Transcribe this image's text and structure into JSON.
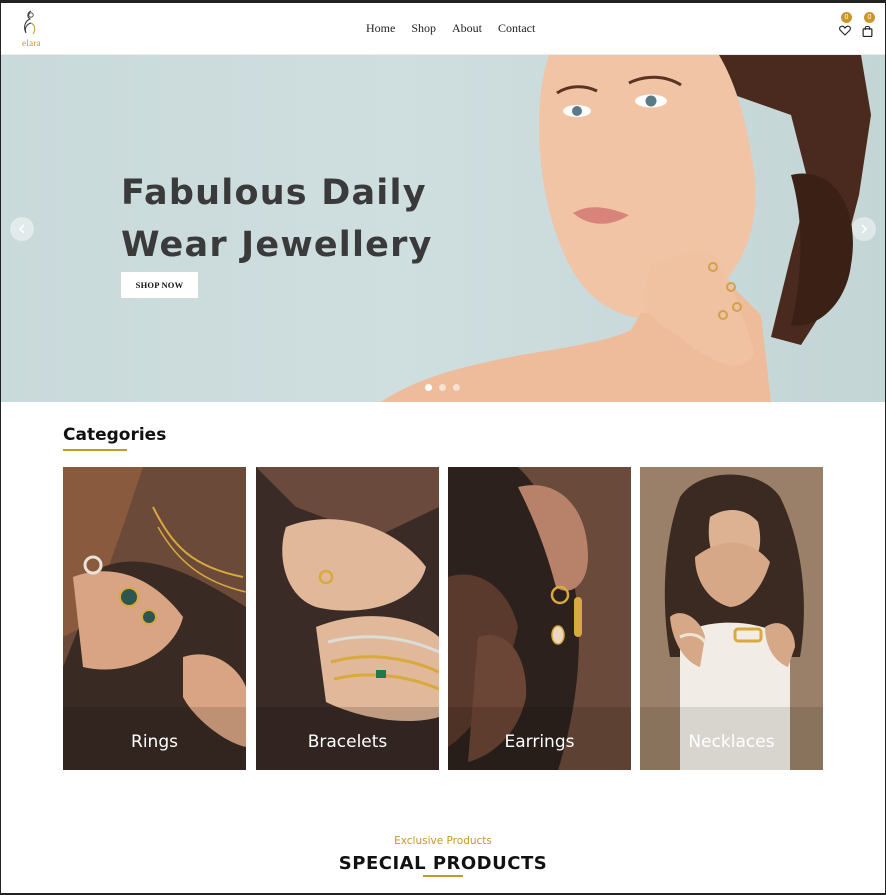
{
  "brand": {
    "logo_text": "elara"
  },
  "nav": {
    "items": [
      "Home",
      "Shop",
      "About",
      "Contact"
    ]
  },
  "header": {
    "wishlist_count": "0",
    "cart_count": "0",
    "wishlist_icon": "heart-icon",
    "cart_icon": "bag-icon"
  },
  "hero": {
    "title_line1": "Fabulous Daily",
    "title_line2": "Wear Jewellery",
    "cta_label": "SHOP NOW",
    "slides": 3,
    "active_slide": 1
  },
  "categories": {
    "title": "Categories",
    "items": [
      {
        "label": "Rings"
      },
      {
        "label": "Bracelets"
      },
      {
        "label": "Earrings"
      },
      {
        "label": "Necklaces"
      }
    ]
  },
  "special": {
    "eyebrow": "Exclusive Products",
    "title": "SPECIAL PRODUCTS"
  },
  "colors": {
    "accent": "#c8962a",
    "hero_bg": "#cbdcdc",
    "text_dark": "#3a3a3a"
  }
}
